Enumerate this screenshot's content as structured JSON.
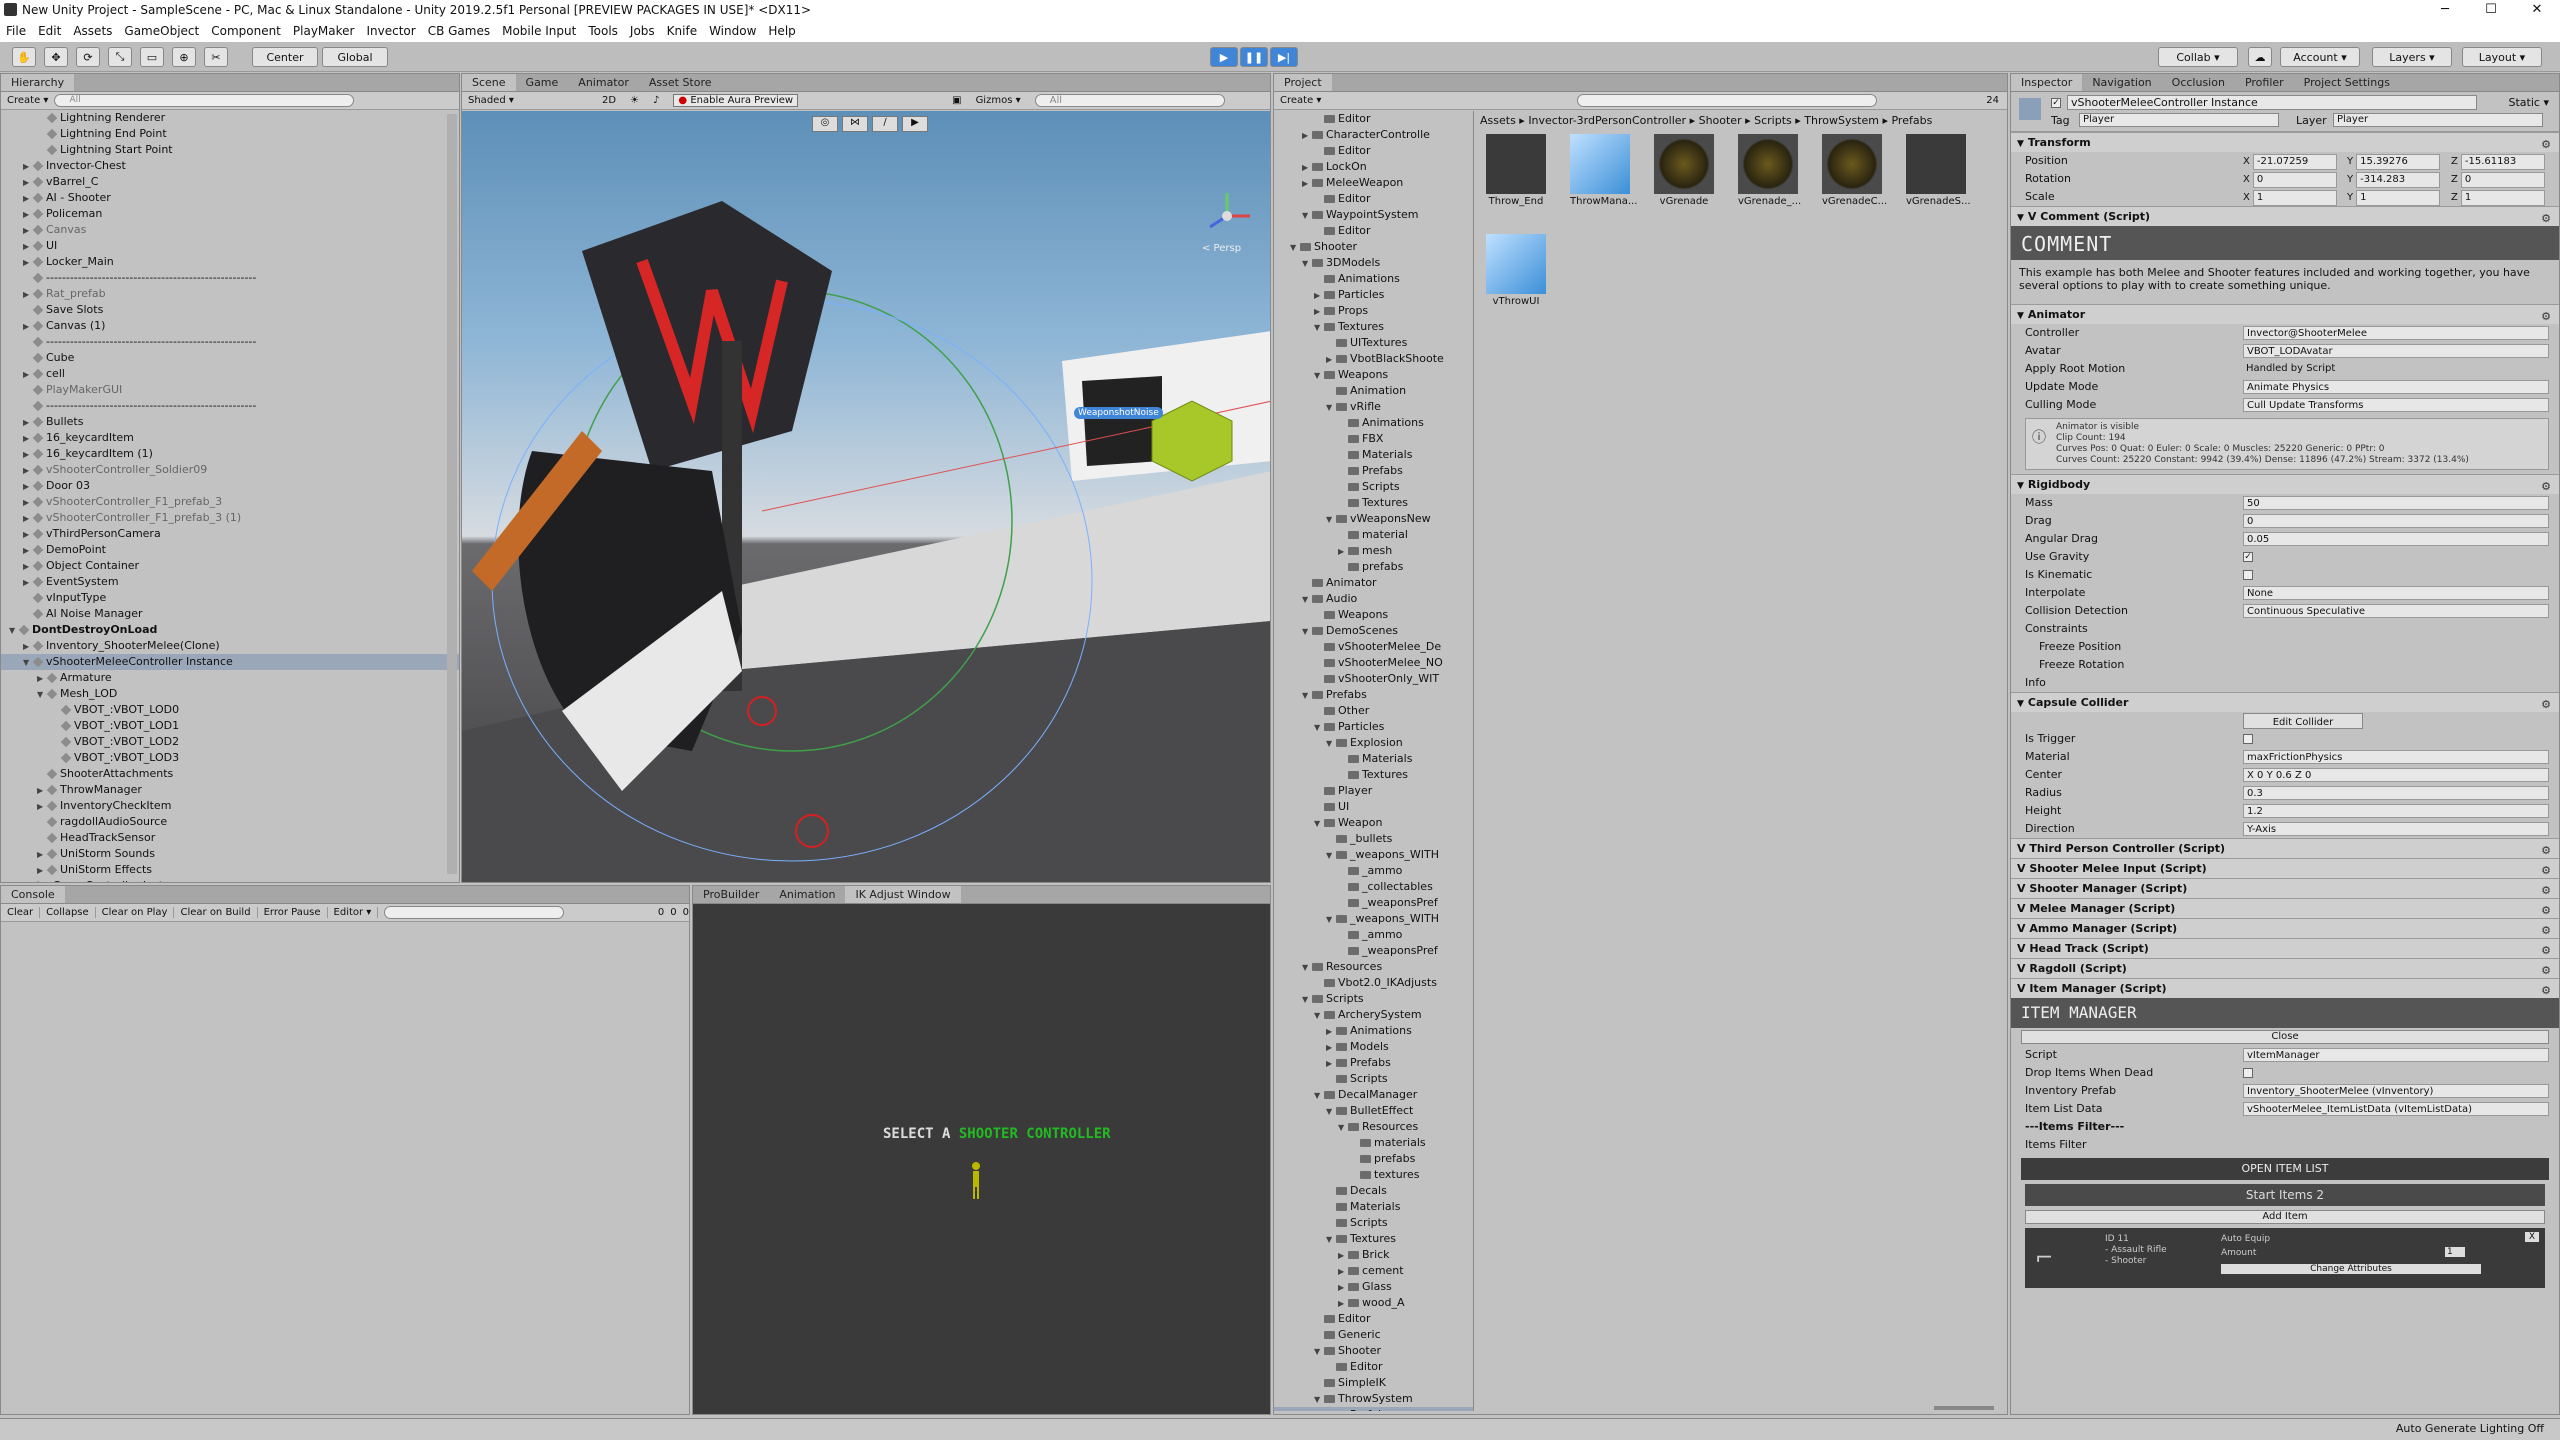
{
  "window": {
    "title": "New Unity Project - SampleScene - PC, Mac & Linux Standalone - Unity 2019.2.5f1 Personal [PREVIEW PACKAGES IN USE]* <DX11>",
    "minimize": "─",
    "maximize": "☐",
    "close": "✕"
  },
  "menu": [
    "File",
    "Edit",
    "Assets",
    "GameObject",
    "Component",
    "PlayMaker",
    "Invector",
    "CB Games",
    "Mobile Input",
    "Tools",
    "Jobs",
    "Knife",
    "Window",
    "Help"
  ],
  "toolbar": {
    "center": "Center",
    "global": "Global",
    "collab": "Collab ▾",
    "account": "Account ▾",
    "layers": "Layers ▾",
    "layout": "Layout ▾"
  },
  "hierarchy": {
    "tab": "Hierarchy",
    "create": "Create ▾",
    "search_placeholder": "All",
    "rows": [
      {
        "indent": 2,
        "label": "Lightning Renderer",
        "arrow": ""
      },
      {
        "indent": 2,
        "label": "Lightning End Point",
        "arrow": ""
      },
      {
        "indent": 2,
        "label": "Lightning Start Point",
        "arrow": ""
      },
      {
        "indent": 1,
        "label": "Invector-Chest",
        "arrow": "▶"
      },
      {
        "indent": 1,
        "label": "vBarrel_C",
        "arrow": "▶"
      },
      {
        "indent": 1,
        "label": "AI - Shooter",
        "arrow": "▶"
      },
      {
        "indent": 1,
        "label": "Policeman",
        "arrow": "▶"
      },
      {
        "indent": 1,
        "label": "Canvas",
        "arrow": "▶",
        "gray": true
      },
      {
        "indent": 1,
        "label": "UI",
        "arrow": "▶"
      },
      {
        "indent": 1,
        "label": "Locker_Main",
        "arrow": "▶"
      },
      {
        "indent": 1,
        "label": "-----------------------------------------------------",
        "arrow": ""
      },
      {
        "indent": 1,
        "label": "Rat_prefab",
        "arrow": "▶",
        "gray": true
      },
      {
        "indent": 1,
        "label": "Save Slots",
        "arrow": ""
      },
      {
        "indent": 1,
        "label": "Canvas (1)",
        "arrow": "▶"
      },
      {
        "indent": 1,
        "label": "-----------------------------------------------------",
        "arrow": ""
      },
      {
        "indent": 1,
        "label": "Cube",
        "arrow": ""
      },
      {
        "indent": 1,
        "label": "cell",
        "arrow": "▶"
      },
      {
        "indent": 1,
        "label": "PlayMakerGUI",
        "arrow": "",
        "gray": true
      },
      {
        "indent": 1,
        "label": "-----------------------------------------------------",
        "arrow": ""
      },
      {
        "indent": 1,
        "label": "Bullets",
        "arrow": "▶"
      },
      {
        "indent": 1,
        "label": "16_keycardItem",
        "arrow": "▶"
      },
      {
        "indent": 1,
        "label": "16_keycardItem (1)",
        "arrow": "▶"
      },
      {
        "indent": 1,
        "label": "vShooterController_Soldier09",
        "arrow": "▶",
        "gray": true
      },
      {
        "indent": 1,
        "label": "Door 03",
        "arrow": "▶"
      },
      {
        "indent": 1,
        "label": "vShooterController_F1_prefab_3",
        "arrow": "▶",
        "gray": true
      },
      {
        "indent": 1,
        "label": "vShooterController_F1_prefab_3 (1)",
        "arrow": "▶",
        "gray": true
      },
      {
        "indent": 1,
        "label": "vThirdPersonCamera",
        "arrow": "▶"
      },
      {
        "indent": 1,
        "label": "DemoPoint",
        "arrow": "▶"
      },
      {
        "indent": 1,
        "label": "Object Container",
        "arrow": "▶"
      },
      {
        "indent": 1,
        "label": "EventSystem",
        "arrow": "▶"
      },
      {
        "indent": 1,
        "label": "vInputType",
        "arrow": ""
      },
      {
        "indent": 1,
        "label": "AI Noise Manager",
        "arrow": ""
      },
      {
        "indent": 0,
        "label": "DontDestroyOnLoad",
        "arrow": "▼",
        "bold": true
      },
      {
        "indent": 1,
        "label": "Inventory_ShooterMelee(Clone)",
        "arrow": "▶"
      },
      {
        "indent": 1,
        "label": "vShooterMeleeController Instance",
        "arrow": "▼",
        "sel": true
      },
      {
        "indent": 2,
        "label": "Armature",
        "arrow": "▶"
      },
      {
        "indent": 2,
        "label": "Mesh_LOD",
        "arrow": "▼"
      },
      {
        "indent": 3,
        "label": "VBOT_:VBOT_LOD0",
        "arrow": ""
      },
      {
        "indent": 3,
        "label": "VBOT_:VBOT_LOD1",
        "arrow": ""
      },
      {
        "indent": 3,
        "label": "VBOT_:VBOT_LOD2",
        "arrow": ""
      },
      {
        "indent": 3,
        "label": "VBOT_:VBOT_LOD3",
        "arrow": ""
      },
      {
        "indent": 2,
        "label": "ShooterAttachments",
        "arrow": ""
      },
      {
        "indent": 2,
        "label": "ThrowManager",
        "arrow": "▶"
      },
      {
        "indent": 2,
        "label": "InventoryCheckItem",
        "arrow": "▶"
      },
      {
        "indent": 2,
        "label": "ragdollAudioSource",
        "arrow": ""
      },
      {
        "indent": 2,
        "label": "HeadTrackSensor",
        "arrow": ""
      },
      {
        "indent": 2,
        "label": "UniStorm Sounds",
        "arrow": "▶"
      },
      {
        "indent": 2,
        "label": "UniStorm Effects",
        "arrow": "▶"
      },
      {
        "indent": 1,
        "label": "vGameController Instance",
        "arrow": ""
      }
    ]
  },
  "scene": {
    "tabs": [
      "Scene",
      "Game",
      "Animator",
      "Asset Store"
    ],
    "shaded": "Shaded ▾",
    "mode2d": "2D",
    "aura": "Enable Aura Preview",
    "gizmos": "Gizmos ▾",
    "search": "All",
    "persp": "< Persp",
    "label": "WeaponshotNoise"
  },
  "console": {
    "tab": "Console",
    "buttons": [
      "Clear",
      "Collapse",
      "Clear on Play",
      "Clear on Build",
      "Error Pause",
      "Editor ▾"
    ],
    "counts": [
      "0",
      "0",
      "0"
    ]
  },
  "ik": {
    "tabs": [
      "ProBuilder",
      "Animation",
      "IK Adjust Window"
    ],
    "select_text": "SELECT A",
    "select_link": "SHOOTER CONTROLLER"
  },
  "project": {
    "tab": "Project",
    "create": "Create ▾",
    "tree": [
      {
        "indent": 3,
        "label": "Editor",
        "arrow": ""
      },
      {
        "indent": 2,
        "label": "CharacterControlle",
        "arrow": "▶"
      },
      {
        "indent": 3,
        "label": "Editor",
        "arrow": ""
      },
      {
        "indent": 2,
        "label": "LockOn",
        "arrow": "▶"
      },
      {
        "indent": 2,
        "label": "MeleeWeapon",
        "arrow": "▶"
      },
      {
        "indent": 3,
        "label": "Editor",
        "arrow": ""
      },
      {
        "indent": 2,
        "label": "WaypointSystem",
        "arrow": "▼"
      },
      {
        "indent": 3,
        "label": "Editor",
        "arrow": ""
      },
      {
        "indent": 1,
        "label": "Shooter",
        "arrow": "▼"
      },
      {
        "indent": 2,
        "label": "3DModels",
        "arrow": "▼"
      },
      {
        "indent": 3,
        "label": "Animations",
        "arrow": ""
      },
      {
        "indent": 3,
        "label": "Particles",
        "arrow": "▶"
      },
      {
        "indent": 3,
        "label": "Props",
        "arrow": "▶"
      },
      {
        "indent": 3,
        "label": "Textures",
        "arrow": "▼"
      },
      {
        "indent": 4,
        "label": "UITextures",
        "arrow": ""
      },
      {
        "indent": 4,
        "label": "VbotBlackShoote",
        "arrow": "▶"
      },
      {
        "indent": 3,
        "label": "Weapons",
        "arrow": "▼"
      },
      {
        "indent": 4,
        "label": "Animation",
        "arrow": ""
      },
      {
        "indent": 4,
        "label": "vRifle",
        "arrow": "▼"
      },
      {
        "indent": 5,
        "label": "Animations",
        "arrow": ""
      },
      {
        "indent": 5,
        "label": "FBX",
        "arrow": ""
      },
      {
        "indent": 5,
        "label": "Materials",
        "arrow": ""
      },
      {
        "indent": 5,
        "label": "Prefabs",
        "arrow": ""
      },
      {
        "indent": 5,
        "label": "Scripts",
        "arrow": ""
      },
      {
        "indent": 5,
        "label": "Textures",
        "arrow": ""
      },
      {
        "indent": 4,
        "label": "vWeaponsNew",
        "arrow": "▼"
      },
      {
        "indent": 5,
        "label": "material",
        "arrow": ""
      },
      {
        "indent": 5,
        "label": "mesh",
        "arrow": "▶"
      },
      {
        "indent": 5,
        "label": "prefabs",
        "arrow": ""
      },
      {
        "indent": 2,
        "label": "Animator",
        "arrow": ""
      },
      {
        "indent": 2,
        "label": "Audio",
        "arrow": "▼"
      },
      {
        "indent": 3,
        "label": "Weapons",
        "arrow": ""
      },
      {
        "indent": 2,
        "label": "DemoScenes",
        "arrow": "▼"
      },
      {
        "indent": 3,
        "label": "vShooterMelee_De",
        "arrow": ""
      },
      {
        "indent": 3,
        "label": "vShooterMelee_NO",
        "arrow": ""
      },
      {
        "indent": 3,
        "label": "vShooterOnly_WIT",
        "arrow": ""
      },
      {
        "indent": 2,
        "label": "Prefabs",
        "arrow": "▼"
      },
      {
        "indent": 3,
        "label": "Other",
        "arrow": ""
      },
      {
        "indent": 3,
        "label": "Particles",
        "arrow": "▼"
      },
      {
        "indent": 4,
        "label": "Explosion",
        "arrow": "▼"
      },
      {
        "indent": 5,
        "label": "Materials",
        "arrow": ""
      },
      {
        "indent": 5,
        "label": "Textures",
        "arrow": ""
      },
      {
        "indent": 3,
        "label": "Player",
        "arrow": ""
      },
      {
        "indent": 3,
        "label": "UI",
        "arrow": ""
      },
      {
        "indent": 3,
        "label": "Weapon",
        "arrow": "▼"
      },
      {
        "indent": 4,
        "label": "_bullets",
        "arrow": ""
      },
      {
        "indent": 4,
        "label": "_weapons_WITH",
        "arrow": "▼"
      },
      {
        "indent": 5,
        "label": "_ammo",
        "arrow": ""
      },
      {
        "indent": 5,
        "label": "_collectables",
        "arrow": ""
      },
      {
        "indent": 5,
        "label": "_weaponsPref",
        "arrow": ""
      },
      {
        "indent": 4,
        "label": "_weapons_WITH",
        "arrow": "▼"
      },
      {
        "indent": 5,
        "label": "_ammo",
        "arrow": ""
      },
      {
        "indent": 5,
        "label": "_weaponsPref",
        "arrow": ""
      },
      {
        "indent": 2,
        "label": "Resources",
        "arrow": "▼"
      },
      {
        "indent": 3,
        "label": "Vbot2.0_IKAdjusts",
        "arrow": ""
      },
      {
        "indent": 2,
        "label": "Scripts",
        "arrow": "▼"
      },
      {
        "indent": 3,
        "label": "ArcherySystem",
        "arrow": "▼"
      },
      {
        "indent": 4,
        "label": "Animations",
        "arrow": "▶"
      },
      {
        "indent": 4,
        "label": "Models",
        "arrow": "▶"
      },
      {
        "indent": 4,
        "label": "Prefabs",
        "arrow": "▶"
      },
      {
        "indent": 4,
        "label": "Scripts",
        "arrow": ""
      },
      {
        "indent": 3,
        "label": "DecalManager",
        "arrow": "▼"
      },
      {
        "indent": 4,
        "label": "BulletEffect",
        "arrow": "▼"
      },
      {
        "indent": 5,
        "label": "Resources",
        "arrow": "▼"
      },
      {
        "indent": 6,
        "label": "materials",
        "arrow": ""
      },
      {
        "indent": 6,
        "label": "prefabs",
        "arrow": ""
      },
      {
        "indent": 6,
        "label": "textures",
        "arrow": ""
      },
      {
        "indent": 4,
        "label": "Decals",
        "arrow": ""
      },
      {
        "indent": 4,
        "label": "Materials",
        "arrow": ""
      },
      {
        "indent": 4,
        "label": "Scripts",
        "arrow": ""
      },
      {
        "indent": 4,
        "label": "Textures",
        "arrow": "▼"
      },
      {
        "indent": 5,
        "label": "Brick",
        "arrow": "▶"
      },
      {
        "indent": 5,
        "label": "cement",
        "arrow": "▶"
      },
      {
        "indent": 5,
        "label": "Glass",
        "arrow": "▶"
      },
      {
        "indent": 5,
        "label": "wood_A",
        "arrow": "▶"
      },
      {
        "indent": 3,
        "label": "Editor",
        "arrow": ""
      },
      {
        "indent": 3,
        "label": "Generic",
        "arrow": ""
      },
      {
        "indent": 3,
        "label": "Shooter",
        "arrow": "▼"
      },
      {
        "indent": 4,
        "label": "Editor",
        "arrow": ""
      },
      {
        "indent": 3,
        "label": "SimpleIK",
        "arrow": ""
      },
      {
        "indent": 3,
        "label": "ThrowSystem",
        "arrow": "▼"
      },
      {
        "indent": 4,
        "label": "Prefabs",
        "arrow": "",
        "sel": true
      }
    ],
    "breadcrumb": "Assets ▸ Invector-3rdPersonController ▸ Shooter ▸ Scripts ▸ ThrowSystem ▸ Prefabs",
    "count": "24",
    "assets": [
      {
        "label": "Throw_End",
        "kind": "dark"
      },
      {
        "label": "ThrowMana...",
        "kind": "cube"
      },
      {
        "label": "vGrenade",
        "kind": "grenade"
      },
      {
        "label": "vGrenade_...",
        "kind": "grenade"
      },
      {
        "label": "vGrenadeC...",
        "kind": "grenade"
      },
      {
        "label": "vGrenadeS...",
        "kind": "dark"
      },
      {
        "label": "vThrowUI",
        "kind": "cube"
      }
    ]
  },
  "inspector": {
    "tabs": [
      "Inspector",
      "Navigation",
      "Occlusion",
      "Profiler",
      "Project Settings"
    ],
    "name": "vShooterMeleeController Instance",
    "static": "Static ▾",
    "tag_label": "Tag",
    "tag": "Player",
    "layer_label": "Layer",
    "layer": "Player",
    "transform": {
      "title": "Transform",
      "position": {
        "label": "Position",
        "x": "-21.07259",
        "y": "15.39276",
        "z": "-15.61183"
      },
      "rotation": {
        "label": "Rotation",
        "x": "0",
        "y": "-314.283",
        "z": "0"
      },
      "scale": {
        "label": "Scale",
        "x": "1",
        "y": "1",
        "z": "1"
      }
    },
    "comment": {
      "title": "V Comment (Script)",
      "banner": "COMMENT",
      "text": "This example has both Melee and Shooter features included and working together, you have several options to play with to create something unique."
    },
    "animator": {
      "title": "Animator",
      "props": [
        {
          "label": "Controller",
          "value": "Invector@ShooterMelee"
        },
        {
          "label": "Avatar",
          "value": "VBOT_LODAvatar"
        },
        {
          "label": "Apply Root Motion",
          "value": "Handled by Script",
          "plain": true
        },
        {
          "label": "Update Mode",
          "value": "Animate Physics"
        },
        {
          "label": "Culling Mode",
          "value": "Cull Update Transforms"
        }
      ],
      "info": [
        "Animator is visible",
        "Clip Count: 194",
        "Curves Pos: 0 Quat: 0 Euler: 0 Scale: 0 Muscles: 25220 Generic: 0 PPtr: 0",
        "Curves Count: 25220 Constant: 9942 (39.4%) Dense: 11896 (47.2%) Stream: 3372 (13.4%)"
      ]
    },
    "rigidbody": {
      "title": "Rigidbody",
      "props": [
        {
          "label": "Mass",
          "value": "50"
        },
        {
          "label": "Drag",
          "value": "0"
        },
        {
          "label": "Angular Drag",
          "value": "0.05"
        },
        {
          "label": "Use Gravity",
          "value": "✓",
          "check": true
        },
        {
          "label": "Is Kinematic",
          "value": "",
          "check": true
        },
        {
          "label": "Interpolate",
          "value": "None"
        },
        {
          "label": "Collision Detection",
          "value": "Continuous Speculative"
        }
      ],
      "constraints": "Constraints",
      "freeze_pos": "Freeze Position",
      "freeze_rot": "Freeze Rotation",
      "info": "Info"
    },
    "capsule": {
      "title": "Capsule Collider",
      "edit": "Edit Collider",
      "props": [
        {
          "label": "Is Trigger",
          "value": "",
          "check": true
        },
        {
          "label": "Material",
          "value": "maxFrictionPhysics"
        },
        {
          "label": "Center",
          "value": "X 0   Y 0.6   Z 0"
        },
        {
          "label": "Radius",
          "value": "0.3"
        },
        {
          "label": "Height",
          "value": "1.2"
        },
        {
          "label": "Direction",
          "value": "Y-Axis"
        }
      ]
    },
    "scripts": [
      "V Third Person Controller (Script)",
      "V Shooter Melee Input (Script)",
      "V Shooter Manager (Script)",
      "V Melee Manager (Script)",
      "V Ammo Manager (Script)",
      "V Head Track (Script)",
      "V Ragdoll (Script)",
      "V Item Manager (Script)"
    ],
    "item_manager": {
      "banner": "ITEM MANAGER",
      "close": "Close",
      "props": [
        {
          "label": "Script",
          "value": "vItemManager"
        },
        {
          "label": "Drop Items When Dead",
          "value": "",
          "check": true
        },
        {
          "label": "Inventory Prefab",
          "value": "Inventory_ShooterMelee (vInventory)"
        },
        {
          "label": "Item List Data",
          "value": "vShooterMelee_ItemListData (vItemListData)"
        }
      ],
      "filter": "---Items Filter---",
      "filter_label": "Items Filter",
      "open": "OPEN ITEM LIST",
      "start": "Start Items 2",
      "add": "Add Item",
      "item": {
        "id": "ID 11",
        "name": "- Assault Rifle",
        "type": "- Shooter",
        "auto": "Auto Equip",
        "amount_label": "Amount",
        "amount": "1",
        "change": "Change Attributes",
        "remove": "X"
      }
    }
  },
  "statusbar": {
    "text": "Auto Generate Lighting Off"
  },
  "colors": {
    "selection": "#9aa7b8",
    "accent_green": "#22bb22",
    "play_blue": "#3f86d8"
  }
}
